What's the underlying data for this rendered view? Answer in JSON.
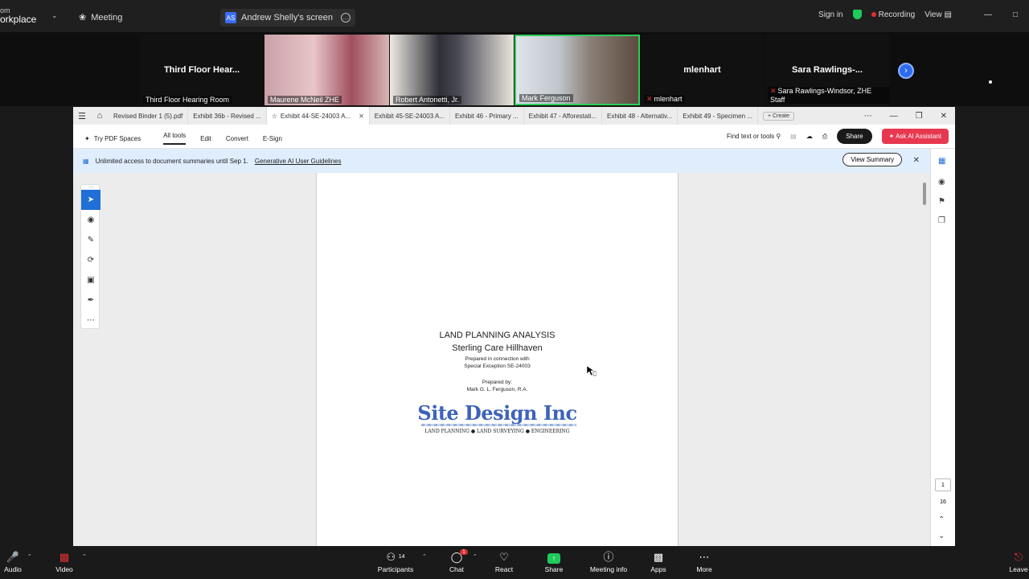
{
  "zoom_top": {
    "brand_line1": "om",
    "brand_line2": "orkplace",
    "meeting_label": "Meeting",
    "screen_initials": "AS",
    "screen_label": "Andrew Shelly's screen",
    "sign_in": "Sign in",
    "recording": "Recording",
    "view": "View"
  },
  "participants": [
    {
      "name": "Third Floor Hearing Room",
      "display": "Third Floor Hear..."
    },
    {
      "name": "Maurene McNeil ZHE"
    },
    {
      "name": "Robert Antonetti, Jr."
    },
    {
      "name": "Mark Ferguson"
    },
    {
      "name": "mlenhart",
      "display": "mlenhart"
    },
    {
      "name": "Sara Rawlings-Windsor, ZHE Staff",
      "display": "Sara  Rawlings-..."
    }
  ],
  "acrobat": {
    "tabs": [
      {
        "label": "Revised Binder 1 (5).pdf"
      },
      {
        "label": "Exhibit 36b - Revised ..."
      },
      {
        "label": "Exhibit 44-SE-24003 A..."
      },
      {
        "label": "Exhibit 45-SE-24003 A..."
      },
      {
        "label": "Exhibit 46 - Primary ..."
      },
      {
        "label": "Exhibit 47 - Afforestati..."
      },
      {
        "label": "Exhibit 48 - Alternativ..."
      },
      {
        "label": "Exhibit 49 - Specimen ..."
      }
    ],
    "create": "Create",
    "toolbar": {
      "try_spaces": "Try PDF Spaces",
      "all_tools": "All tools",
      "edit": "Edit",
      "convert": "Convert",
      "esign": "E-Sign",
      "find": "Find text or tools",
      "share": "Share",
      "ai": "Ask AI Assistant"
    },
    "banner": {
      "text": "Unlimited access to document summaries until Sep 1.",
      "link": "Generative AI User Guidelines",
      "view_summary": "View Summary"
    },
    "document": {
      "title": "LAND PLANNING ANALYSIS",
      "subtitle": "Sterling Care Hillhaven",
      "prepared_conn": "Prepared in connection with",
      "exception": "Special Exception SE-24003",
      "prepared_by": "Prepared by:",
      "author": "Mark G. L. Ferguson, R.A.",
      "logo": "Site Design Inc",
      "logo_tag": "LAND PLANNING ● LAND SURVEYING ● ENGINEERING"
    },
    "page_current": "1",
    "page_total": "16"
  },
  "zoom_bottom": {
    "audio": "Audio",
    "video": "Video",
    "participants": "Participants",
    "participants_count": "14",
    "chat": "Chat",
    "chat_badge": "1",
    "react": "React",
    "share": "Share",
    "meeting_info": "Meeting info",
    "apps": "Apps",
    "more": "More",
    "leave": "Leave"
  }
}
